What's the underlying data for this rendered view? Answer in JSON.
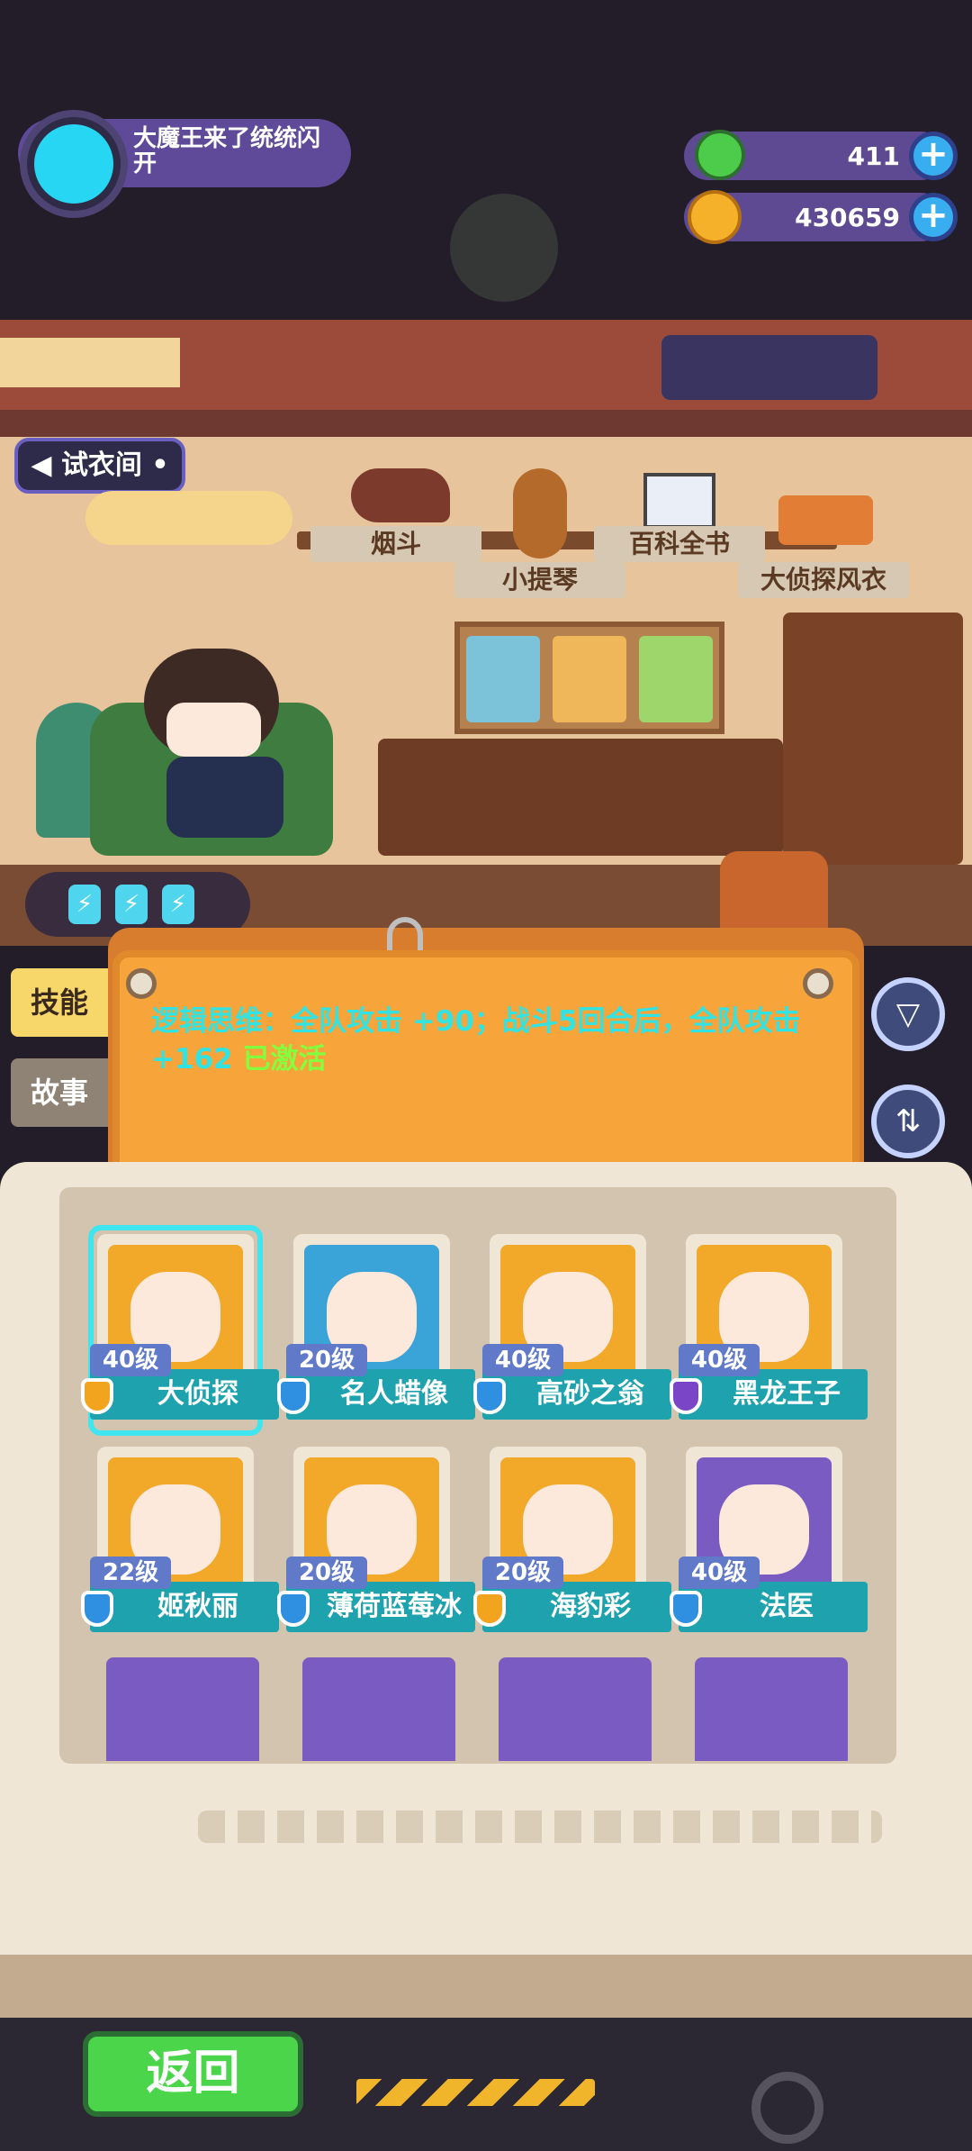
{
  "player": {
    "name": "大魔王来了统统闪开"
  },
  "resources": [
    {
      "icon": "donut-gem-icon",
      "value": "411"
    },
    {
      "icon": "gold-planet-coin-icon",
      "value": "430659"
    }
  ],
  "room": {
    "wardrobe_label": "试衣间",
    "items": [
      "烟斗",
      "小提琴",
      "百科全书",
      "大侦探风衣"
    ]
  },
  "skill": {
    "text": "逻辑思维：全队攻击 +90；战斗5回合后，全队攻击 +162",
    "status": "已激活"
  },
  "tabs": {
    "skill": "技能",
    "story": "故事"
  },
  "characters": [
    {
      "level": "40级",
      "name": "大侦探",
      "rarity": "gold",
      "bg": "#f2a829"
    },
    {
      "level": "20级",
      "name": "名人蜡像",
      "rarity": "blue",
      "bg": "#3aa3d8"
    },
    {
      "level": "40级",
      "name": "高砂之翁",
      "rarity": "blue",
      "bg": "#f2a829"
    },
    {
      "level": "40级",
      "name": "黑龙王子",
      "rarity": "purple",
      "bg": "#f2a829"
    },
    {
      "level": "22级",
      "name": "姬秋丽",
      "rarity": "blue",
      "bg": "#f2a829"
    },
    {
      "level": "20级",
      "name": "薄荷蓝莓冰",
      "rarity": "blue",
      "bg": "#f2a829"
    },
    {
      "level": "20级",
      "name": "海豹彩",
      "rarity": "gold",
      "bg": "#f2a829"
    },
    {
      "level": "40级",
      "name": "法医",
      "rarity": "blue",
      "bg": "#7a5bc2"
    }
  ],
  "back_label": "返回",
  "colors": {
    "accent_cyan": "#32e3e3",
    "active_green": "#83ff3e",
    "panel_orange": "#f7a43a"
  }
}
